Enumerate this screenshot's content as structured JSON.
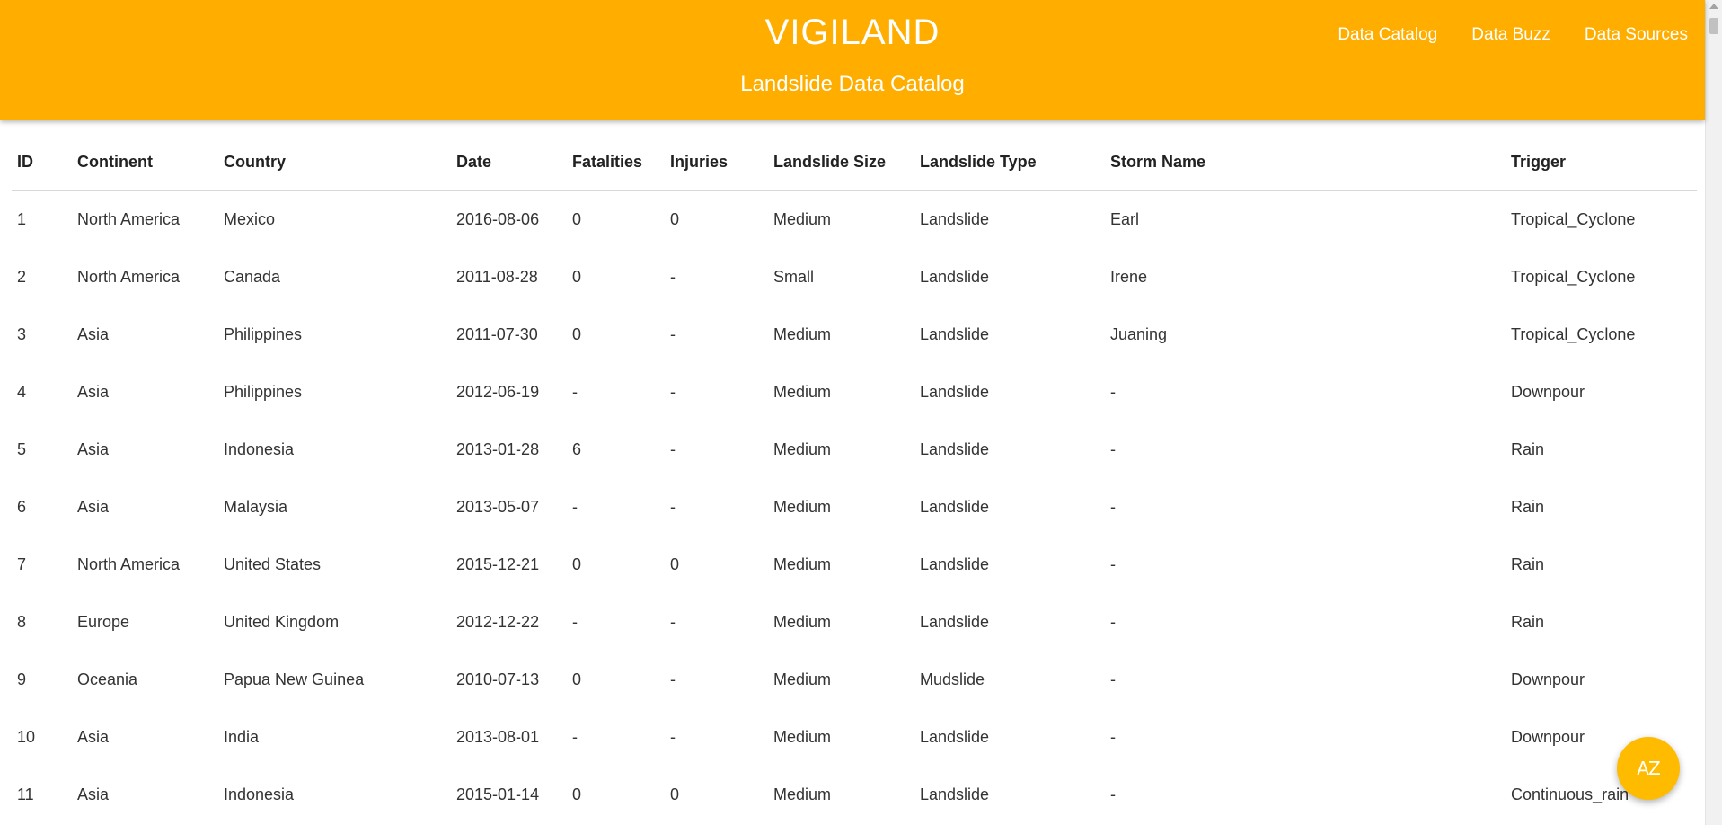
{
  "header": {
    "brand": "VIGILAND",
    "subtitle": "Landslide Data Catalog",
    "nav": [
      "Data Catalog",
      "Data Buzz",
      "Data Sources"
    ]
  },
  "table": {
    "columns": [
      "ID",
      "Continent",
      "Country",
      "Date",
      "Fatalities",
      "Injuries",
      "Landslide Size",
      "Landslide Type",
      "Storm Name",
      "Trigger"
    ],
    "rows": [
      [
        "1",
        "North America",
        "Mexico",
        "2016-08-06",
        "0",
        "0",
        "Medium",
        "Landslide",
        "Earl",
        "Tropical_Cyclone"
      ],
      [
        "2",
        "North America",
        "Canada",
        "2011-08-28",
        "0",
        "-",
        "Small",
        "Landslide",
        "Irene",
        "Tropical_Cyclone"
      ],
      [
        "3",
        "Asia",
        "Philippines",
        "2011-07-30",
        "0",
        "-",
        "Medium",
        "Landslide",
        "Juaning",
        "Tropical_Cyclone"
      ],
      [
        "4",
        "Asia",
        "Philippines",
        "2012-06-19",
        "-",
        "-",
        "Medium",
        "Landslide",
        "-",
        "Downpour"
      ],
      [
        "5",
        "Asia",
        "Indonesia",
        "2013-01-28",
        "6",
        "-",
        "Medium",
        "Landslide",
        "-",
        "Rain"
      ],
      [
        "6",
        "Asia",
        "Malaysia",
        "2013-05-07",
        "-",
        "-",
        "Medium",
        "Landslide",
        "-",
        "Rain"
      ],
      [
        "7",
        "North America",
        "United States",
        "2015-12-21",
        "0",
        "0",
        "Medium",
        "Landslide",
        "-",
        "Rain"
      ],
      [
        "8",
        "Europe",
        "United Kingdom",
        "2012-12-22",
        "-",
        "-",
        "Medium",
        "Landslide",
        "-",
        "Rain"
      ],
      [
        "9",
        "Oceania",
        "Papua New Guinea",
        "2010-07-13",
        "0",
        "-",
        "Medium",
        "Mudslide",
        "-",
        "Downpour"
      ],
      [
        "10",
        "Asia",
        "India",
        "2013-08-01",
        "-",
        "-",
        "Medium",
        "Landslide",
        "-",
        "Downpour"
      ],
      [
        "11",
        "Asia",
        "Indonesia",
        "2015-01-14",
        "0",
        "0",
        "Medium",
        "Landslide",
        "-",
        "Continuous_rain"
      ]
    ]
  },
  "fab": {
    "icon": "sort-az-icon",
    "label": "AZ"
  },
  "colors": {
    "header_bg": "#FFAE00",
    "fab_bg": "#FFBB00"
  }
}
